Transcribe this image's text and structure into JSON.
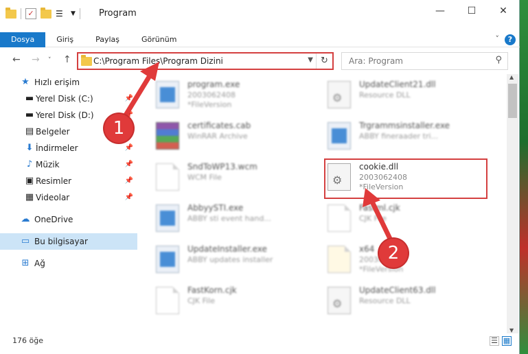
{
  "window": {
    "title": "Program",
    "minimize": "—",
    "maximize": "☐",
    "close": "✕"
  },
  "ribbon": {
    "tabs": [
      "Dosya",
      "Giriş",
      "Paylaş",
      "Görünüm"
    ],
    "help": "?"
  },
  "address": {
    "path": "C:\\Program Files\\Program Dizini",
    "search_placeholder": "Ara: Program"
  },
  "sidebar": {
    "quick_access": "Hızlı erişim",
    "items": [
      "Yerel Disk (C:)",
      "Yerel Disk (D:)",
      "Belgeler",
      "İndirmeler",
      "Müzik",
      "Resimler",
      "Videolar"
    ],
    "onedrive": "OneDrive",
    "this_pc": "Bu bilgisayar",
    "network": "Ağ"
  },
  "files": [
    {
      "name": "program.exe",
      "l1": "2003062408",
      "l2": "*FileVersion"
    },
    {
      "name": "UpdateClient21.dll",
      "l1": "Resource DLL",
      "l2": ""
    },
    {
      "name": "certificates.cab",
      "l1": "WinRAR Archive",
      "l2": ""
    },
    {
      "name": "Trgrammsinstaller.exe",
      "l1": "ABBY fineraader tri...",
      "l2": ""
    },
    {
      "name": "SndToWP13.wcm",
      "l1": "WCM File",
      "l2": ""
    },
    {
      "name": "cookie.dll",
      "l1": "2003062408",
      "l2": "*FileVersion"
    },
    {
      "name": "AbbyySTI.exe",
      "l1": "ABBY sti event hand...",
      "l2": ""
    },
    {
      "name": "Fastml.cjk",
      "l1": "CJK File",
      "l2": ""
    },
    {
      "name": "UpdateInstaller.exe",
      "l1": "ABBY updates installer",
      "l2": ""
    },
    {
      "name": "x64",
      "l1": "2003062408",
      "l2": "*FileVersion"
    },
    {
      "name": "FastKorn.cjk",
      "l1": "CJK File",
      "l2": ""
    },
    {
      "name": "UpdateClient63.dll",
      "l1": "Resource DLL",
      "l2": ""
    }
  ],
  "status": {
    "count": "176 öğe"
  },
  "annotations": {
    "step1": "1",
    "step2": "2"
  },
  "colors": {
    "accent": "#1979ca",
    "highlight": "#d43f3f"
  }
}
